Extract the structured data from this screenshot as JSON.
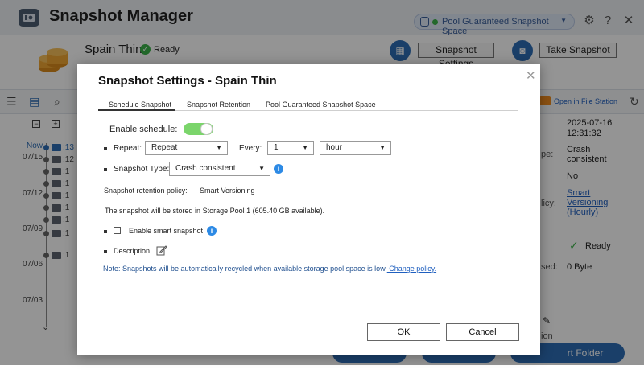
{
  "app": {
    "title": "Snapshot Manager",
    "pool_selector": "Pool Guaranteed Snapshot Space"
  },
  "volume": {
    "name": "Spain Thin",
    "status": "Ready"
  },
  "header_buttons": {
    "snapshot_settings": "Snapshot Settings",
    "take_snapshot": "Take Snapshot"
  },
  "toolbar": {
    "open_in_file_station": "Open in File Station"
  },
  "timeline": {
    "now_label": "Now",
    "dates": [
      "07/15",
      "07/12",
      "07/09",
      "07/06",
      "07/03"
    ],
    "entries": [
      ":13",
      ":12",
      ":1",
      ":1",
      ":1",
      ":1",
      ":1",
      ":1",
      ":1"
    ]
  },
  "right_panel": {
    "date": "2025-07-16",
    "time": "12:31:32",
    "type_partial": "pe:",
    "type_value": "Crash consistent",
    "no_value": "No",
    "policy_partial": "licy:",
    "policy_link": "Smart Versioning (Hourly)",
    "ready": "Ready",
    "used_partial": "sed:",
    "used_value": "0 Byte",
    "bottom_partial": "ion"
  },
  "bottom_button": "rt Folder Snapshot",
  "dialog": {
    "title": "Snapshot Settings - Spain Thin",
    "tabs": [
      "Schedule Snapshot",
      "Snapshot Retention",
      "Pool Guaranteed Snapshot Space"
    ],
    "enable_schedule_label": "Enable schedule:",
    "enable_schedule_on": true,
    "repeat_label": "Repeat:",
    "repeat_value": "Repeat",
    "every_label": "Every:",
    "every_value": "1",
    "unit_value": "hour",
    "snapshot_type_label": "Snapshot Type:",
    "snapshot_type_value": "Crash consistent",
    "retention_label": "Snapshot retention policy:",
    "retention_link": "Smart Versioning",
    "storage_text": "The snapshot will be stored in Storage Pool 1 (605.40 GB available).",
    "smart_snapshot_label": "Enable smart snapshot",
    "description_label": "Description",
    "note_text": "Note: Snapshots will be automatically recycled when available storage pool space is low.",
    "change_policy": " Change policy.",
    "ok": "OK",
    "cancel": "Cancel"
  },
  "colors": {
    "accent": "#2d6db5",
    "toggle_on": "#7bd56b",
    "ready_green": "#3db34a",
    "link": "#1f5fbf"
  }
}
